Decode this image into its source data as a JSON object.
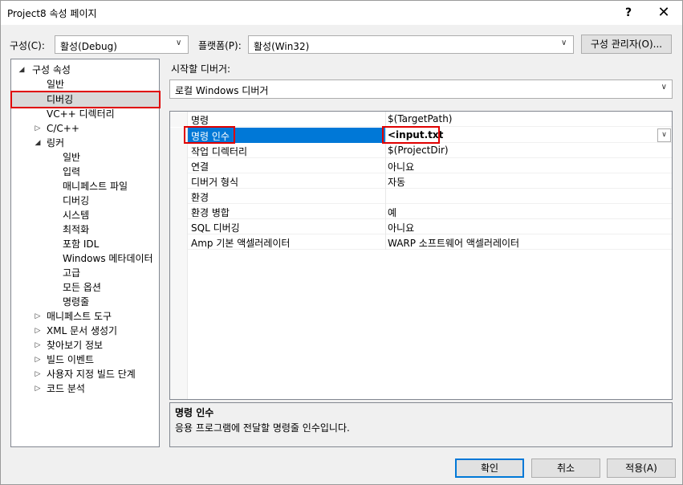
{
  "window": {
    "title": "Project8 속성 페이지",
    "help_label": "?",
    "close_label": "✕"
  },
  "config": {
    "label": "구성(C):",
    "value": "활성(Debug)",
    "platform_label": "플랫폼(P):",
    "platform_value": "활성(Win32)",
    "manager_button": "구성 관리자(O)..."
  },
  "tree": {
    "root": "구성 속성",
    "items": [
      {
        "label": "일반"
      },
      {
        "label": "디버깅"
      },
      {
        "label": "VC++ 디렉터리"
      },
      {
        "label": "C/C++"
      },
      {
        "label": "링커"
      },
      {
        "label": "일반"
      },
      {
        "label": "입력"
      },
      {
        "label": "매니페스트 파일"
      },
      {
        "label": "디버깅"
      },
      {
        "label": "시스템"
      },
      {
        "label": "최적화"
      },
      {
        "label": "포함 IDL"
      },
      {
        "label": "Windows 메타데이터"
      },
      {
        "label": "고급"
      },
      {
        "label": "모든 옵션"
      },
      {
        "label": "명령줄"
      },
      {
        "label": "매니페스트 도구"
      },
      {
        "label": "XML 문서 생성기"
      },
      {
        "label": "찾아보기 정보"
      },
      {
        "label": "빌드 이벤트"
      },
      {
        "label": "사용자 지정 빌드 단계"
      },
      {
        "label": "코드 분석"
      }
    ]
  },
  "debugger": {
    "label": "시작할 디버거:",
    "value": "로컬 Windows 디버거"
  },
  "properties": [
    {
      "name": "명령",
      "value": "$(TargetPath)"
    },
    {
      "name": "명령 인수",
      "value": "<input.txt"
    },
    {
      "name": "작업 디렉터리",
      "value": "$(ProjectDir)"
    },
    {
      "name": "연결",
      "value": "아니요"
    },
    {
      "name": "디버거 형식",
      "value": "자동"
    },
    {
      "name": "환경",
      "value": ""
    },
    {
      "name": "환경 병합",
      "value": "예"
    },
    {
      "name": "SQL 디버깅",
      "value": "아니요"
    },
    {
      "name": "Amp 기본 액셀러레이터",
      "value": "WARP 소프트웨어 액셀러레이터"
    }
  ],
  "description": {
    "title": "명령 인수",
    "text": "응용 프로그램에 전달할 명령줄 인수입니다."
  },
  "buttons": {
    "ok": "확인",
    "cancel": "취소",
    "apply": "적용(A)"
  },
  "colors": {
    "selection": "#0078d7",
    "highlight_box": "#e00000"
  }
}
